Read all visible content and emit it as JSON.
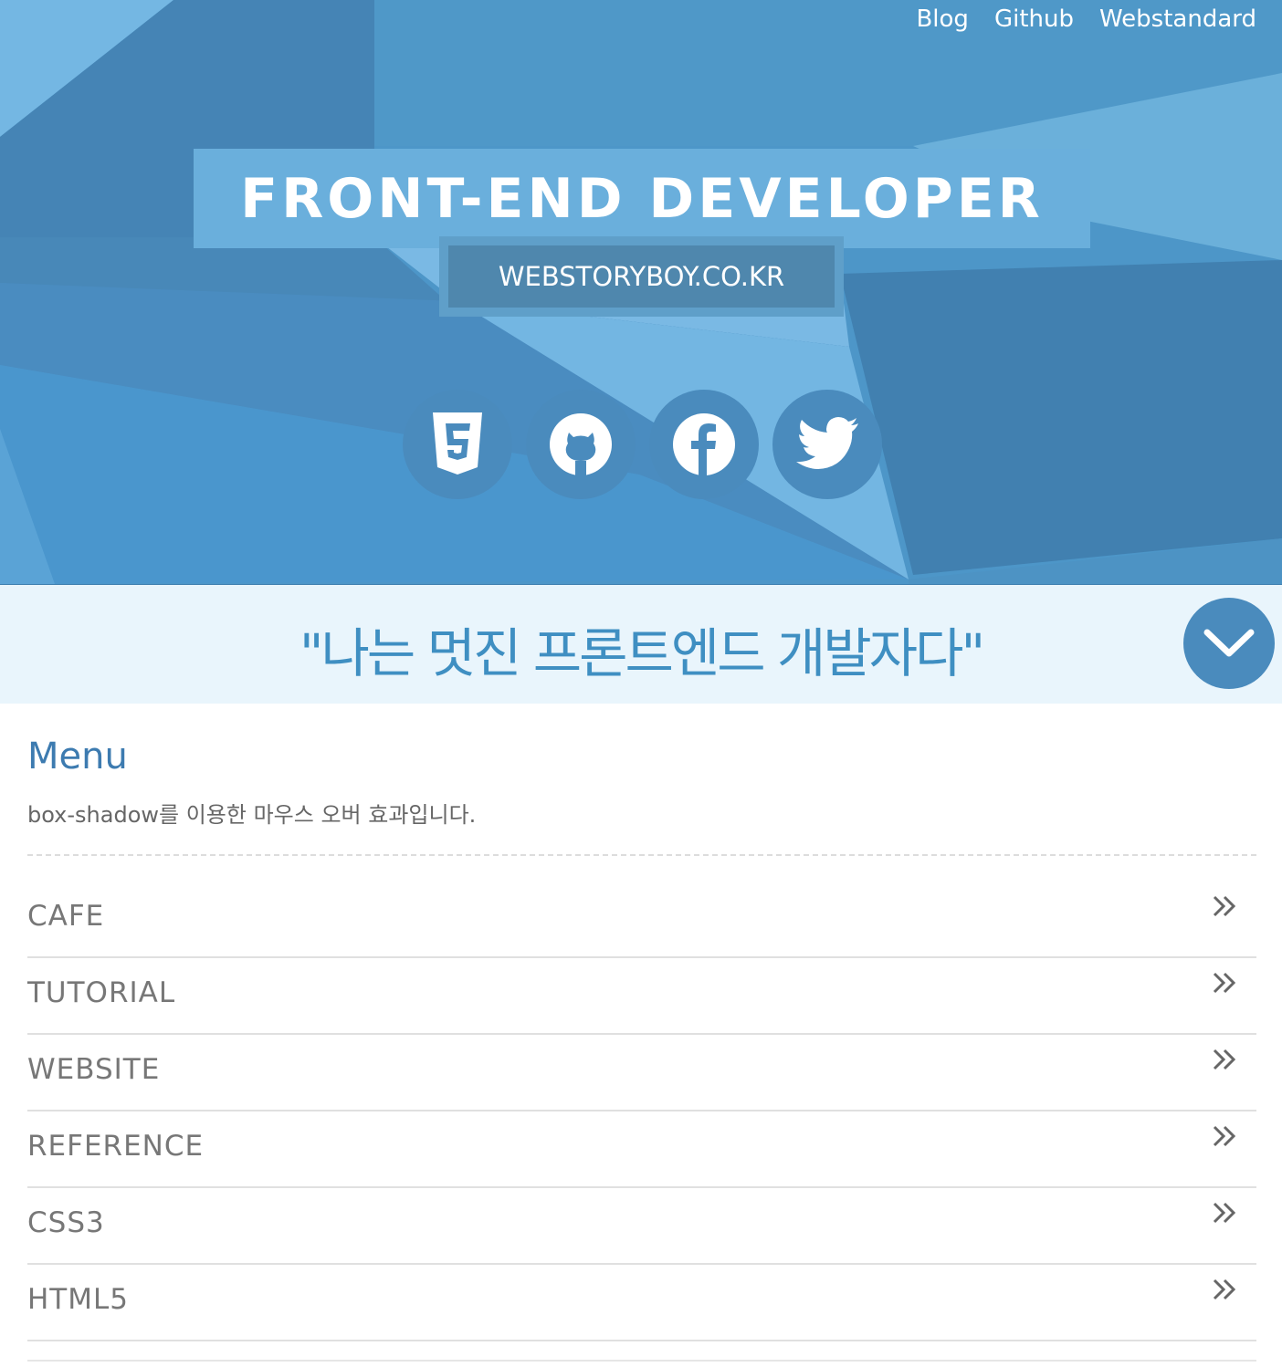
{
  "nav": {
    "links": [
      "Blog",
      "Github",
      "Webstandard"
    ]
  },
  "hero": {
    "title": "FRONT-END DEVELOPER",
    "subtitle": "WEBSTORYBOY.CO.KR",
    "social_icons": [
      "html5-icon",
      "github-icon",
      "facebook-icon",
      "twitter-icon"
    ]
  },
  "slogan": {
    "text": "\"나는 멋진 프론트엔드 개발자다\""
  },
  "menu": {
    "title": "Menu",
    "description": "box-shadow를 이용한 마우스 오버 효과입니다.",
    "items": [
      "CAFE",
      "TUTORIAL",
      "WEBSITE",
      "REFERENCE",
      "CSS3",
      "HTML5"
    ]
  },
  "colors": {
    "hero_blue": "#4c94c7",
    "title_box": "#6aafdc",
    "slogan_bg": "#e9f5fc",
    "slogan_text": "#3f8fc2",
    "menu_title": "#3d7bb0"
  }
}
